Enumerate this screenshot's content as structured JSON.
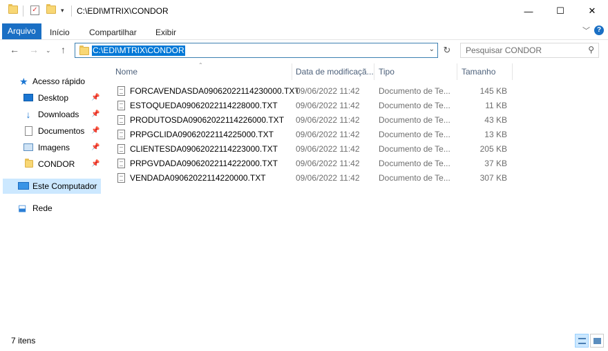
{
  "window": {
    "title": "C:\\EDI\\MTRIX\\CONDOR",
    "minimize_symbol": "—",
    "maximize_symbol": "☐",
    "close_symbol": "✕"
  },
  "ribbon": {
    "tabs": [
      "Arquivo",
      "Início",
      "Compartilhar",
      "Exibir"
    ]
  },
  "address": {
    "path": "C:\\EDI\\MTRIX\\CONDOR",
    "search_placeholder": "Pesquisar CONDOR"
  },
  "nav": {
    "quick_access": "Acesso rápido",
    "items": [
      {
        "label": "Desktop",
        "icon": "desktop-icon"
      },
      {
        "label": "Downloads",
        "icon": "download-icon"
      },
      {
        "label": "Documentos",
        "icon": "documents-icon"
      },
      {
        "label": "Imagens",
        "icon": "pictures-icon"
      },
      {
        "label": "CONDOR",
        "icon": "folder-icon"
      }
    ],
    "this_pc": "Este Computador",
    "network": "Rede"
  },
  "columns": {
    "name": "Nome",
    "date": "Data de modificaçã...",
    "type": "Tipo",
    "size": "Tamanho"
  },
  "files": [
    {
      "name": "FORCAVENDASDA09062022114230000.TXT",
      "date": "09/06/2022 11:42",
      "type": "Documento de Te...",
      "size": "145 KB"
    },
    {
      "name": "ESTOQUEDA09062022114228000.TXT",
      "date": "09/06/2022 11:42",
      "type": "Documento de Te...",
      "size": "11 KB"
    },
    {
      "name": "PRODUTOSDA09062022114226000.TXT",
      "date": "09/06/2022 11:42",
      "type": "Documento de Te...",
      "size": "43 KB"
    },
    {
      "name": "PRPGCLIDA09062022114225000.TXT",
      "date": "09/06/2022 11:42",
      "type": "Documento de Te...",
      "size": "13 KB"
    },
    {
      "name": "CLIENTESDA09062022114223000.TXT",
      "date": "09/06/2022 11:42",
      "type": "Documento de Te...",
      "size": "205 KB"
    },
    {
      "name": "PRPGVDADA09062022114222000.TXT",
      "date": "09/06/2022 11:42",
      "type": "Documento de Te...",
      "size": "37 KB"
    },
    {
      "name": "VENDADA09062022114220000.TXT",
      "date": "09/06/2022 11:42",
      "type": "Documento de Te...",
      "size": "307 KB"
    }
  ],
  "status": {
    "count": "7 itens"
  }
}
